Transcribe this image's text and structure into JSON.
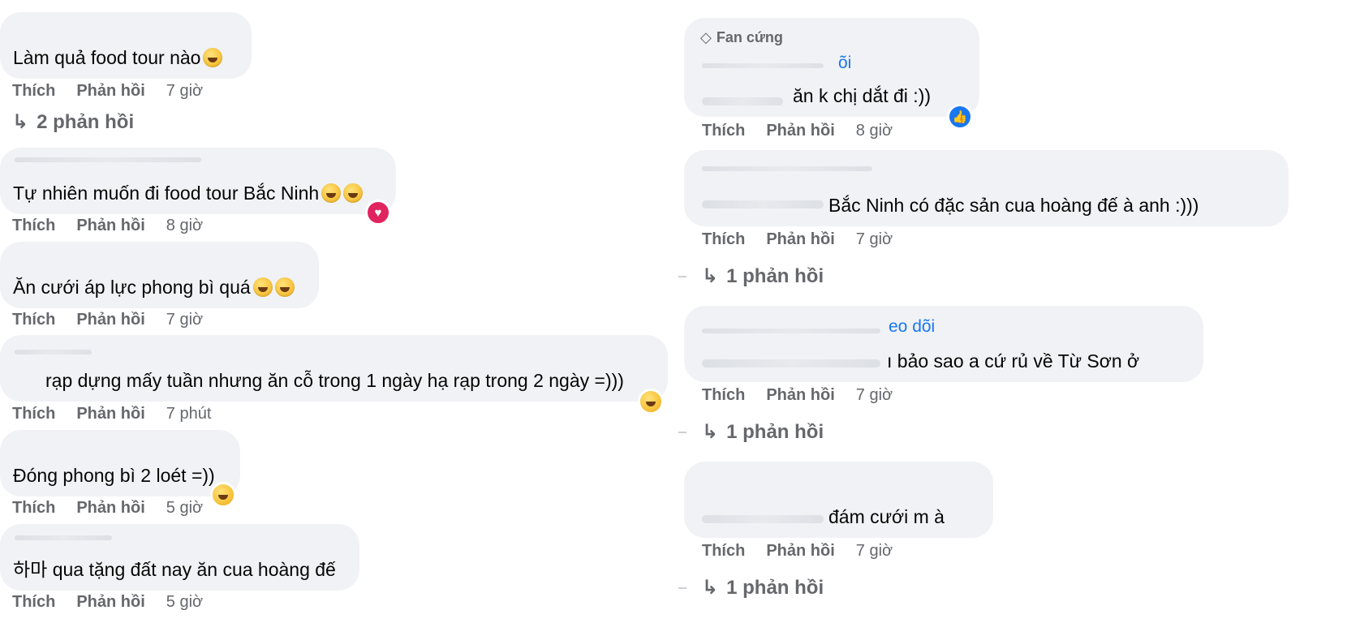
{
  "left": [
    {
      "text": "Làm quả food tour nào",
      "emoji": "rofl-emoji",
      "like": "Thích",
      "reply": "Phản hồi",
      "time": "7 giờ",
      "replies": "2 phản hồi"
    },
    {
      "text": "Tự nhiên muốn đi food tour Bắc Ninh",
      "emoji": "joy-emoji",
      "like": "Thích",
      "reply": "Phản hồi",
      "time": "8 giờ",
      "reaction": "heart-reaction"
    },
    {
      "text": "Ăn cưới áp lực phong bì quá",
      "emoji": "joy-emoji",
      "like": "Thích",
      "reply": "Phản hồi",
      "time": "7 giờ"
    },
    {
      "text": "rạp dựng mấy tuần nhưng ăn cỗ trong 1 ngày hạ rạp trong 2 ngày =)))",
      "like": "Thích",
      "reply": "Phản hồi",
      "time": "7 phút",
      "reaction": "haha-reaction"
    },
    {
      "text": "Đóng phong bì 2 loét =))",
      "like": "Thích",
      "reply": "Phản hồi",
      "time": "5 giờ",
      "reaction": "haha-reaction"
    },
    {
      "text": "하마 qua tặng đất nay ăn cua hoàng đế",
      "like": "Thích",
      "reply": "Phản hồi",
      "time": "5 giờ"
    }
  ],
  "right": [
    {
      "badge": "Fan cứng",
      "badge_icon": "diamond-icon",
      "follow": "õi",
      "text": "ăn k chị dắt đi :))",
      "like": "Thích",
      "reply": "Phản hồi",
      "time": "8 giờ",
      "reaction": "like-reaction"
    },
    {
      "text": "Bắc Ninh có đặc sản cua hoàng đế à anh :)))",
      "like": "Thích",
      "reply": "Phản hồi",
      "time": "7 giờ",
      "replies": "1 phản hồi"
    },
    {
      "follow": "eo dõi",
      "text": "ı bảo sao a cứ rủ về Từ Sơn ở",
      "like": "Thích",
      "reply": "Phản hồi",
      "time": "7 giờ",
      "replies": "1 phản hồi"
    },
    {
      "text": "đám cưới m à",
      "like": "Thích",
      "reply": "Phản hồi",
      "time": "7 giờ",
      "replies": "1 phản hồi"
    }
  ]
}
